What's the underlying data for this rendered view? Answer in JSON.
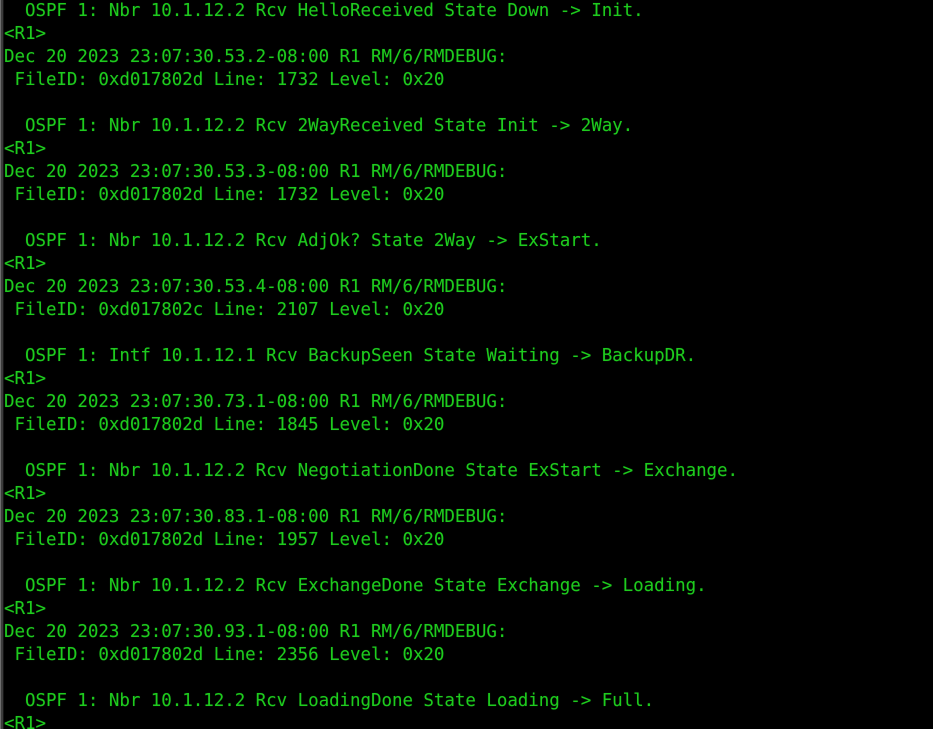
{
  "terminal": {
    "app_kind": "network-device-cli",
    "device_prompt": "<R1>",
    "foreground_color": "#1ecb1e",
    "background_color": "#000000",
    "font_size_px": 17.5,
    "line_height_px": 23,
    "columns": 77,
    "rows": 32,
    "lines": [
      "  OSPF 1: Nbr 10.1.12.2 Rcv HelloReceived State Down -> Init.",
      "<R1>",
      "Dec 20 2023 23:07:30.53.2-08:00 R1 RM/6/RMDEBUG:",
      " FileID: 0xd017802d Line: 1732 Level: 0x20",
      "",
      "  OSPF 1: Nbr 10.1.12.2 Rcv 2WayReceived State Init -> 2Way.",
      "<R1>",
      "Dec 20 2023 23:07:30.53.3-08:00 R1 RM/6/RMDEBUG:",
      " FileID: 0xd017802d Line: 1732 Level: 0x20",
      "",
      "  OSPF 1: Nbr 10.1.12.2 Rcv AdjOk? State 2Way -> ExStart.",
      "<R1>",
      "Dec 20 2023 23:07:30.53.4-08:00 R1 RM/6/RMDEBUG:",
      " FileID: 0xd017802c Line: 2107 Level: 0x20",
      "",
      "  OSPF 1: Intf 10.1.12.1 Rcv BackupSeen State Waiting -> BackupDR.",
      "<R1>",
      "Dec 20 2023 23:07:30.73.1-08:00 R1 RM/6/RMDEBUG:",
      " FileID: 0xd017802d Line: 1845 Level: 0x20",
      "",
      "  OSPF 1: Nbr 10.1.12.2 Rcv NegotiationDone State ExStart -> Exchange.",
      "<R1>",
      "Dec 20 2023 23:07:30.83.1-08:00 R1 RM/6/RMDEBUG:",
      " FileID: 0xd017802d Line: 1957 Level: 0x20",
      "",
      "  OSPF 1: Nbr 10.1.12.2 Rcv ExchangeDone State Exchange -> Loading.",
      "<R1>",
      "Dec 20 2023 23:07:30.93.1-08:00 R1 RM/6/RMDEBUG:",
      " FileID: 0xd017802d Line: 2356 Level: 0x20",
      "",
      "  OSPF 1: Nbr 10.1.12.2 Rcv LoadingDone State Loading -> Full.",
      "<R1>"
    ]
  }
}
